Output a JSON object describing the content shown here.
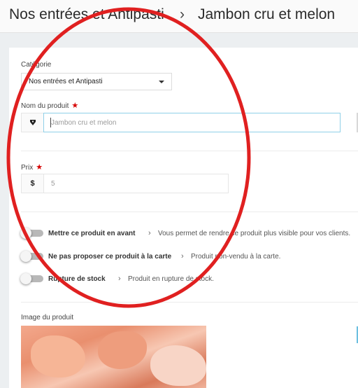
{
  "header": {
    "breadcrumb_category": "Nos entrées et Antipasti",
    "breadcrumb_separator": "›",
    "breadcrumb_product": "Jambon cru et melon"
  },
  "form": {
    "category": {
      "label": "Catégorie",
      "selected": "Nos entrées et Antipasti"
    },
    "product_name": {
      "label": "Nom du produit",
      "required_mark": "★",
      "addon_icon": "tag-icon",
      "placeholder": "Jambon cru et melon",
      "value": ""
    },
    "price": {
      "label": "Prix",
      "required_mark": "★",
      "addon_symbol": "$",
      "placeholder": "5",
      "value": ""
    },
    "options": [
      {
        "label": "Mettre ce produit en avant",
        "description": "Vous permet de rendre ce produit plus visible pour vos clients.",
        "enabled": false
      },
      {
        "label": "Ne pas proposer ce produit à la carte",
        "description": "Produit non-vendu à la carte.",
        "enabled": false
      },
      {
        "label": "Rupture de stock",
        "description": "Produit en rupture de stock.",
        "enabled": false
      }
    ],
    "image": {
      "label": "Image du produit"
    }
  },
  "colors": {
    "required": "#d60000",
    "annotation_circle": "#e02020",
    "focus_border": "#8fd0e8"
  }
}
